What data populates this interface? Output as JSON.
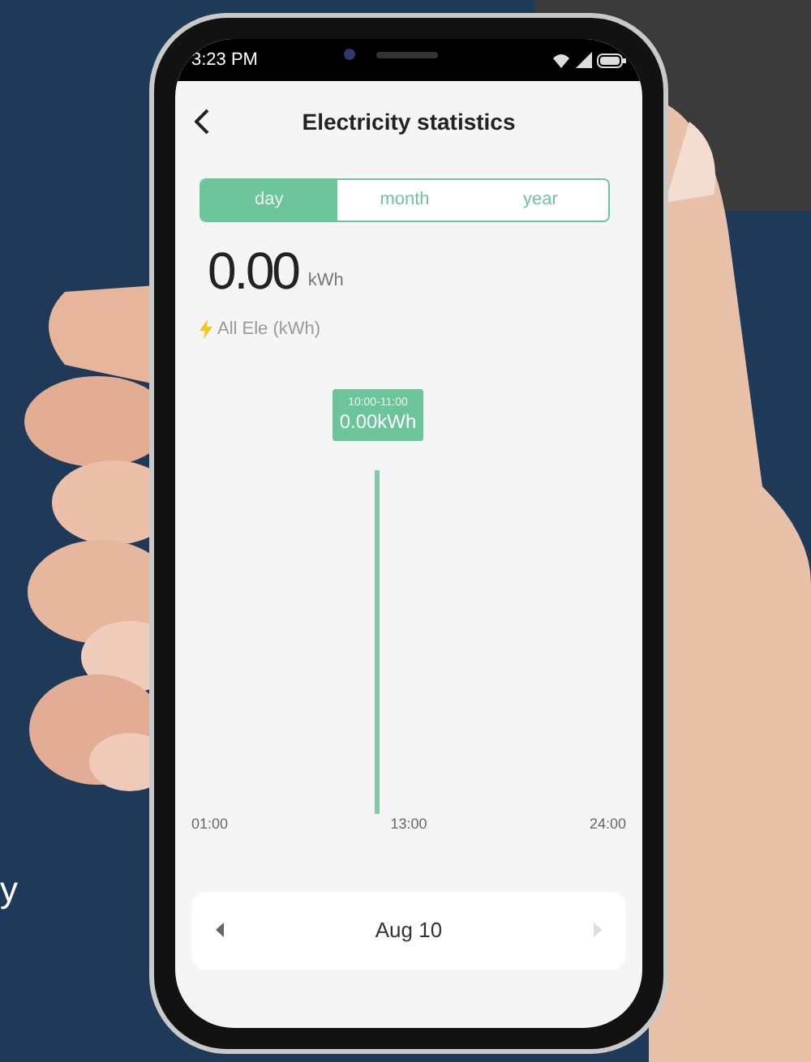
{
  "background_text": "y",
  "status_bar": {
    "time": "3:23 PM"
  },
  "header": {
    "title": "Electricity statistics"
  },
  "tabs": [
    {
      "label": "day",
      "selected": true
    },
    {
      "label": "month",
      "selected": false
    },
    {
      "label": "year",
      "selected": false
    }
  ],
  "total": {
    "value": "0.00",
    "unit": "kWh"
  },
  "legend": {
    "label": "All Ele (kWh)"
  },
  "chart": {
    "tooltip": {
      "time": "10:00-11:00",
      "value": "0.00kWh"
    },
    "x_labels": [
      "01:00",
      "13:00",
      "24:00"
    ]
  },
  "date_picker": {
    "date": "Aug 10",
    "prev_disabled": false,
    "next_disabled": true
  }
}
